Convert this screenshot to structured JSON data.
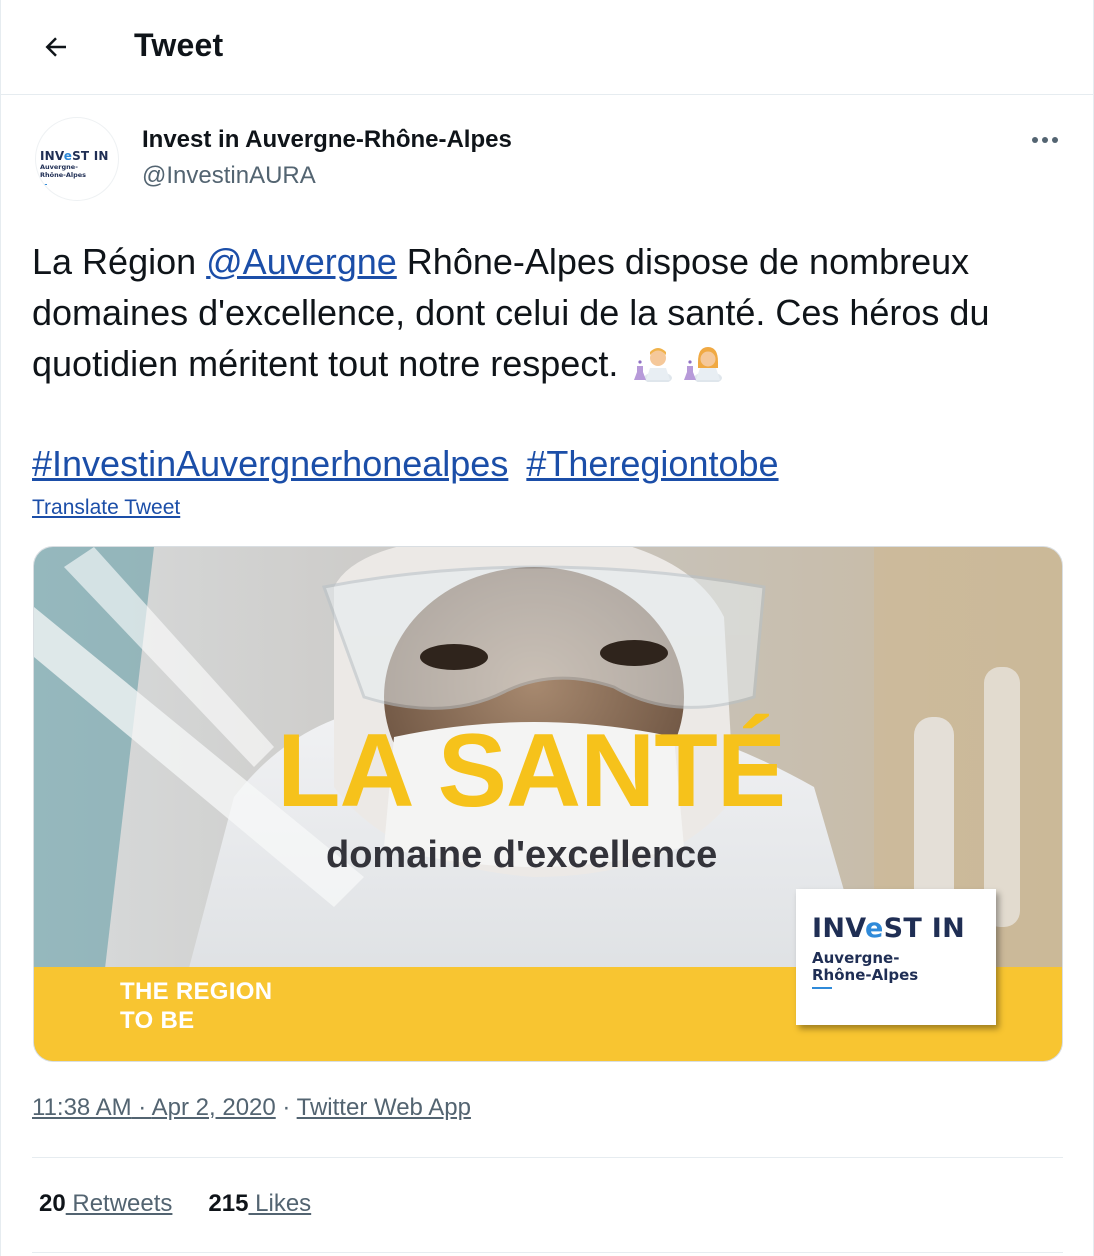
{
  "header": {
    "title": "Tweet",
    "back_icon": "arrow-left-icon"
  },
  "tweet": {
    "author": {
      "display_name": "Invest in Auvergne-Rhône-Alpes",
      "handle": "@InvestinAURA",
      "avatar_brand_pre": "INV",
      "avatar_brand_e": "e",
      "avatar_brand_post": "ST IN",
      "avatar_sub": "Auvergne-\nRhône-Alpes"
    },
    "text": {
      "part1": "La Région ",
      "mention": "@Auvergne",
      "part2": " Rhône-Alpes dispose de nombreux domaines d'excellence, dont celui de la santé. Ces héros du quotidien méritent tout notre respect. ",
      "emoji_1": "man-scientist-emoji",
      "emoji_2": "woman-scientist-emoji"
    },
    "hashtags": [
      "#InvestinAuvergnerhonealpes",
      "#Theregiontobe"
    ],
    "translate_label": "Translate Tweet",
    "media": {
      "headline": "LA SANTÉ",
      "subline": "domaine d'excellence",
      "band_text": "THE REGION\nTO BE",
      "logo_brand_pre": "INV",
      "logo_brand_e": "e",
      "logo_brand_post": "ST IN",
      "logo_sub": "Auvergne-\nRhône-Alpes",
      "accent_color": "#f8c531"
    },
    "time": "11:38 AM",
    "date": "Apr 2, 2020",
    "separator": " · ",
    "source": "Twitter Web App",
    "retweets_count": "20",
    "retweets_label": " Retweets",
    "likes_count": "215",
    "likes_label": " Likes"
  },
  "colors": {
    "link": "#1b4ea8",
    "secondary_text": "#536471",
    "brand_navy": "#1f2e54"
  }
}
